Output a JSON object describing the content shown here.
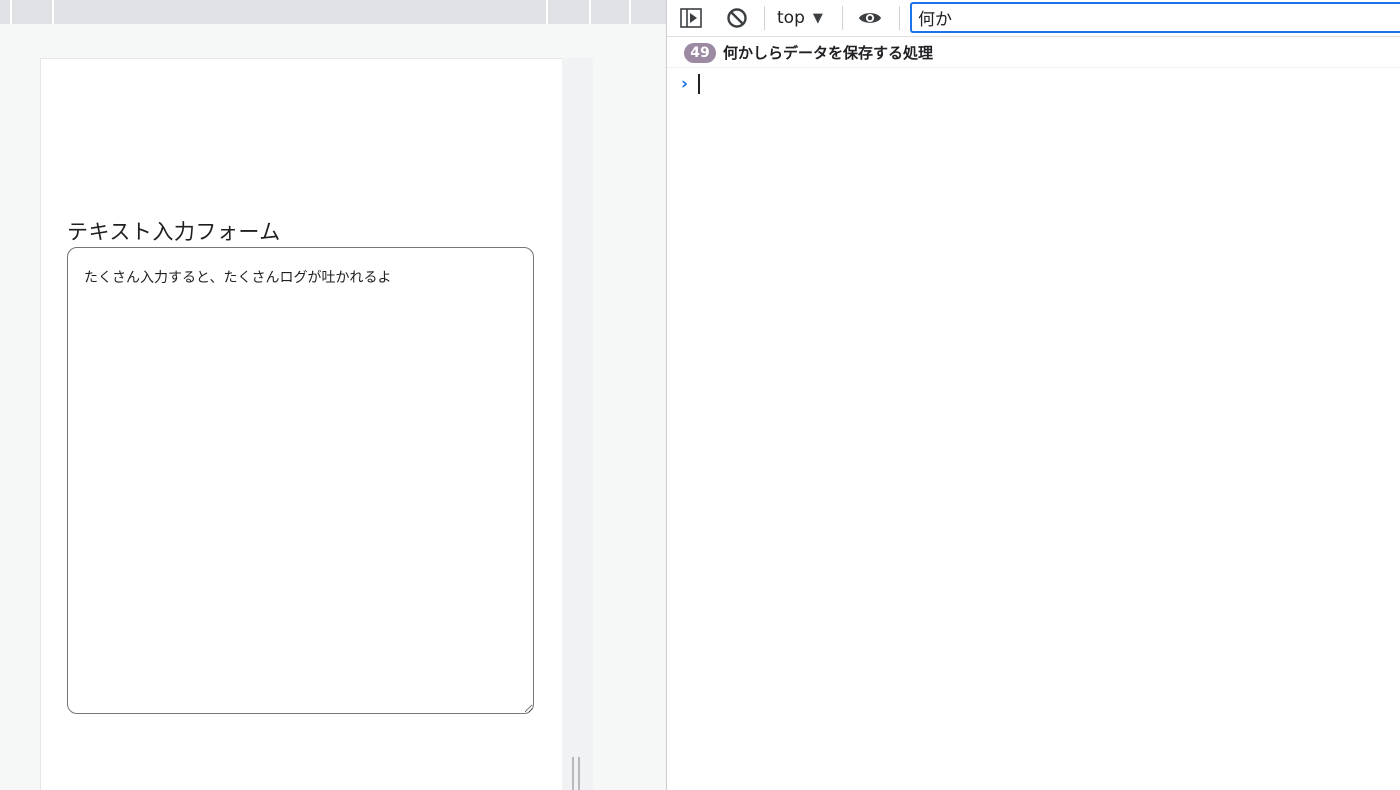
{
  "preview": {
    "form_label": "テキスト入力フォーム",
    "textarea_value": "たくさん入力すると、たくさんログが吐かれるよ"
  },
  "devtools": {
    "toolbar": {
      "sidebar_icon": "sidebar-toggle-icon",
      "clear_icon": "clear-console-icon",
      "context": "top",
      "context_caret": "▼",
      "eye_icon": "live-expression-icon",
      "filter_value": "何か"
    },
    "log": {
      "repeat_count": "49",
      "message": "何かしらデータを保存する処理"
    },
    "prompt": {
      "chevron": "›"
    }
  },
  "colors": {
    "accent": "#1a73e8",
    "badge": "#9c8aa3"
  }
}
